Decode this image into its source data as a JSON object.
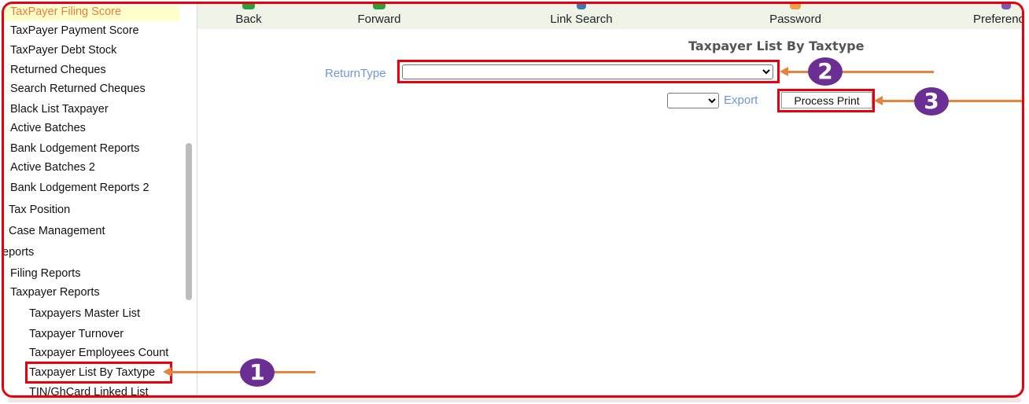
{
  "sidebar": {
    "items": [
      {
        "label": "TaxPayer Filing Score"
      },
      {
        "label": "TaxPayer Payment Score"
      },
      {
        "label": "TaxPayer Debt Stock"
      },
      {
        "label": "Returned Cheques"
      },
      {
        "label": "Search Returned Cheques"
      },
      {
        "label": "Black List Taxpayer"
      },
      {
        "label": "Active Batches"
      },
      {
        "label": "Bank Lodgement Reports"
      },
      {
        "label": "Active Batches 2"
      },
      {
        "label": "Bank Lodgement Reports 2"
      },
      {
        "label": "Tax Position"
      },
      {
        "label": "Case Management"
      },
      {
        "label": "eports"
      },
      {
        "label": "Filing Reports"
      },
      {
        "label": "Taxpayer Reports"
      },
      {
        "label": "Taxpayers Master List"
      },
      {
        "label": "Taxpayer Turnover"
      },
      {
        "label": "Taxpayer Employees Count"
      },
      {
        "label": "Taxpayer List By Taxtype"
      },
      {
        "label": "TIN/GhCard Linked List"
      }
    ]
  },
  "toolbar": {
    "back": "Back",
    "forward": "Forward",
    "link_search": "Link Search",
    "password": "Password",
    "preferences": "Preferenc"
  },
  "main": {
    "title": "Taxpayer List By Taxtype",
    "return_type_label": "ReturnType",
    "return_type_value": "",
    "export_value": "",
    "export_label": "Export",
    "process_print_label": "Process Print"
  },
  "annotations": {
    "step1": "1",
    "step2": "2",
    "step3": "3",
    "highlight_color": "#e8000f",
    "arrow_color": "#e8823c",
    "badge_color": "#6b2f93"
  }
}
